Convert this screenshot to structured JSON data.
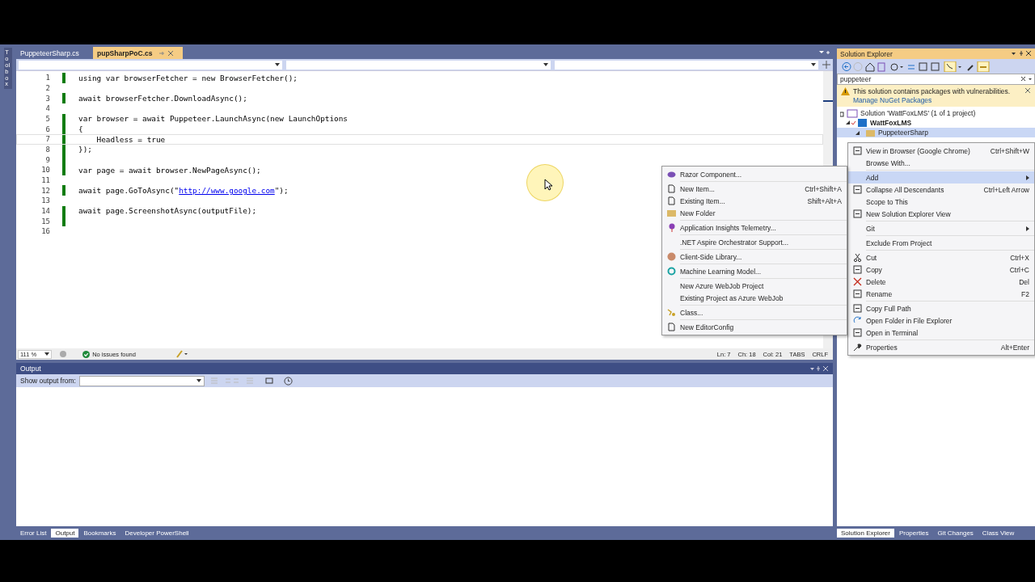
{
  "toolbox": {
    "label": "Toolbox"
  },
  "editor_tabs": [
    {
      "label": "PuppeteerSharp.cs",
      "selected": false
    },
    {
      "label": "pupSharpPoC.cs",
      "selected": true
    }
  ],
  "code_lines": [
    {
      "number": "1",
      "text": "using var browserFetcher = new BrowserFetcher();",
      "modified": true,
      "current": false
    },
    {
      "number": "2",
      "modified": false,
      "current": false
    },
    {
      "number": "3",
      "text": "await browserFetcher.DownloadAsync();",
      "modified": true,
      "current": false
    },
    {
      "number": "4",
      "modified": false,
      "current": false
    },
    {
      "number": "5",
      "text": "var browser = await Puppeteer.LaunchAsync(new LaunchOptions",
      "modified": true,
      "current": false
    },
    {
      "number": "6",
      "text": "{",
      "modified": true,
      "current": false
    },
    {
      "number": "7",
      "text": "    Headless = true",
      "modified": true,
      "current": true
    },
    {
      "number": "8",
      "text": "});",
      "modified": true,
      "current": false
    },
    {
      "number": "9",
      "modified": true,
      "current": false
    },
    {
      "number": "10",
      "text": "var page = await browser.NewPageAsync();",
      "modified": true,
      "current": false
    },
    {
      "number": "11",
      "modified": false,
      "current": false
    },
    {
      "number": "12",
      "text": "await page.GoToAsync(\"",
      "link": "http://www.google.com",
      "after": "\");",
      "modified": true,
      "current": false
    },
    {
      "number": "13",
      "modified": false,
      "current": false
    },
    {
      "number": "14",
      "text": "await page.ScreenshotAsync(outputFile);",
      "modified": true,
      "current": false
    },
    {
      "number": "15",
      "modified": true,
      "current": false
    },
    {
      "number": "16",
      "modified": false,
      "current": false
    }
  ],
  "editor_status": {
    "zoom": "111 %",
    "issues": "No issues found",
    "line": "Ln: 7",
    "char": "Ch: 18",
    "column": "Col: 21",
    "indent": "TABS",
    "line_ending": "CRLF"
  },
  "output_panel": {
    "title": "Output",
    "source_label": "Show output from:"
  },
  "bottom_tabs_left": [
    {
      "label": "Error List",
      "selected": false
    },
    {
      "label": "Output",
      "selected": true
    },
    {
      "label": "Bookmarks",
      "selected": false
    },
    {
      "label": "Developer PowerShell",
      "selected": false
    }
  ],
  "solution_explorer": {
    "title": "Solution Explorer",
    "search": "puppeteer",
    "warning": {
      "text": "This solution contains packages with vulnerabilities.",
      "link": "Manage NuGet Packages"
    },
    "tree": [
      {
        "label": "Solution 'WattFoxLMS' (1 of 1 project)",
        "children": [
          {
            "label": "WattFoxLMS",
            "expanded": true,
            "children": [
              {
                "label": "PuppeteerSharp",
                "expanded": true,
                "selected": true
              }
            ]
          }
        ]
      }
    ]
  },
  "bottom_tabs_right": [
    {
      "label": "Solution Explorer",
      "selected": true
    },
    {
      "label": "Properties",
      "selected": false
    },
    {
      "label": "Git Changes",
      "selected": false
    },
    {
      "label": "Class View",
      "selected": false
    }
  ],
  "context_menu": [
    {
      "kind": "item",
      "label": "View in Browser (Google Chrome)",
      "shortcut": "Ctrl+Shift+W",
      "selected": false,
      "submenu": false
    },
    {
      "kind": "item",
      "label": "Browse With...",
      "selected": false,
      "submenu": false
    },
    {
      "kind": "separator"
    },
    {
      "kind": "item",
      "label": "Add",
      "selected": true,
      "submenu": true
    },
    {
      "kind": "item",
      "label": "Collapse All Descendants",
      "shortcut": "Ctrl+Left Arrow",
      "selected": false,
      "submenu": false
    },
    {
      "kind": "item",
      "label": "Scope to This",
      "selected": false,
      "submenu": false
    },
    {
      "kind": "item",
      "label": "New Solution Explorer View",
      "selected": false,
      "submenu": false
    },
    {
      "kind": "separator"
    },
    {
      "kind": "item",
      "label": "Git",
      "selected": false,
      "submenu": true
    },
    {
      "kind": "separator"
    },
    {
      "kind": "item",
      "label": "Exclude From Project",
      "selected": false,
      "submenu": false
    },
    {
      "kind": "separator"
    },
    {
      "kind": "item",
      "label": "Cut",
      "shortcut": "Ctrl+X",
      "selected": false,
      "submenu": false
    },
    {
      "kind": "item",
      "label": "Copy",
      "shortcut": "Ctrl+C",
      "selected": false,
      "submenu": false
    },
    {
      "kind": "item",
      "label": "Delete",
      "shortcut": "Del",
      "selected": false,
      "submenu": false
    },
    {
      "kind": "item",
      "label": "Rename",
      "shortcut": "F2",
      "selected": false,
      "submenu": false
    },
    {
      "kind": "separator"
    },
    {
      "kind": "item",
      "label": "Copy Full Path",
      "selected": false,
      "submenu": false
    },
    {
      "kind": "item",
      "label": "Open Folder in File Explorer",
      "selected": false,
      "submenu": false
    },
    {
      "kind": "item",
      "label": "Open in Terminal",
      "selected": false,
      "submenu": false
    },
    {
      "kind": "separator"
    },
    {
      "kind": "item",
      "label": "Properties",
      "shortcut": "Alt+Enter",
      "selected": false,
      "submenu": false
    }
  ],
  "add_submenu": [
    {
      "kind": "item",
      "label": "Razor Component..."
    },
    {
      "kind": "separator"
    },
    {
      "kind": "item",
      "label": "New Item...",
      "shortcut": "Ctrl+Shift+A"
    },
    {
      "kind": "item",
      "label": "Existing Item...",
      "shortcut": "Shift+Alt+A"
    },
    {
      "kind": "item",
      "label": "New Folder"
    },
    {
      "kind": "separator"
    },
    {
      "kind": "item",
      "label": "Application Insights Telemetry..."
    },
    {
      "kind": "separator"
    },
    {
      "kind": "item",
      "label": ".NET Aspire Orchestrator Support..."
    },
    {
      "kind": "separator"
    },
    {
      "kind": "item",
      "label": "Client-Side Library..."
    },
    {
      "kind": "separator"
    },
    {
      "kind": "item",
      "label": "Machine Learning Model..."
    },
    {
      "kind": "separator"
    },
    {
      "kind": "item",
      "label": "New Azure WebJob Project"
    },
    {
      "kind": "item",
      "label": "Existing Project as Azure WebJob"
    },
    {
      "kind": "separator"
    },
    {
      "kind": "item",
      "label": "Class..."
    },
    {
      "kind": "separator"
    },
    {
      "kind": "item",
      "label": "New EditorConfig"
    }
  ]
}
